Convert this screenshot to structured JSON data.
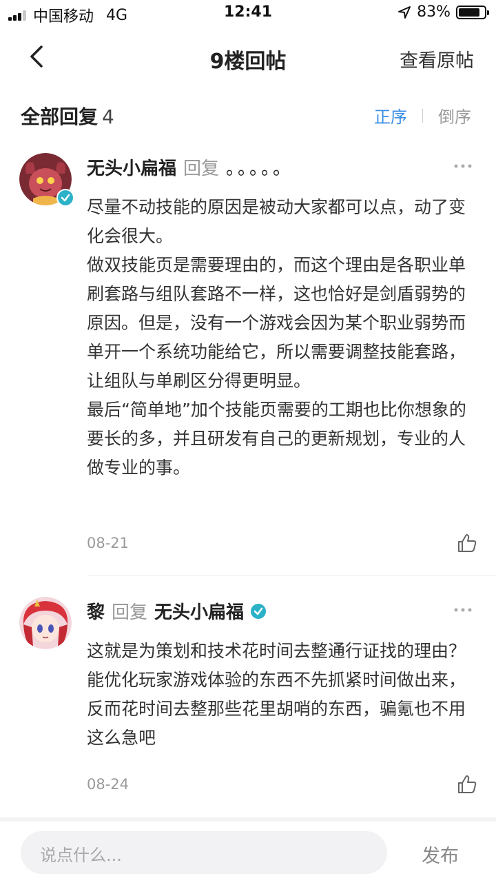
{
  "status_bar": {
    "carrier": "中国移动",
    "network": "4G",
    "time": "12:41",
    "battery": "83%",
    "battery_level": 0.83
  },
  "nav": {
    "title": "9楼回帖",
    "action": "查看原帖"
  },
  "replies_header": {
    "title": "全部回复",
    "count": "4",
    "sort_asc": "正序",
    "sort_desc": "倒序"
  },
  "replies": [
    {
      "author": "无头小扁福",
      "reply_word": "回复",
      "reply_to": "。。。。。",
      "paragraphs": [
        "尽量不动技能的原因是被动大家都可以点，动了变化会很大。",
        "做双技能页是需要理由的，而这个理由是各职业单刷套路与组队套路不一样，这也恰好是剑盾弱势的原因。但是，没有一个游戏会因为某个职业弱势而单开一个系统功能给它，所以需要调整技能套路，让组队与单刷区分得更明显。",
        "最后“简单地”加个技能页需要的工期也比你想象的要长的多，并且研发有自己的更新规划，专业的人做专业的事。"
      ],
      "date": "08-21"
    },
    {
      "author": "黎",
      "reply_word": "回复",
      "reply_to": "无头小扁福",
      "paragraphs": [
        "这就是为策划和技术花时间去整通行证找的理由？能优化玩家游戏体验的东西不先抓紧时间做出来，反而花时间去整那些花里胡哨的东西，骗氪也不用这么急吧"
      ],
      "date": "08-24"
    }
  ],
  "footer": {
    "input_placeholder": "说点什么...",
    "publish_label": "发布"
  },
  "colors": {
    "accent": "#3a8ee6",
    "verified": "#2bb1c8",
    "muted": "#9a9a9a"
  },
  "icons": [
    "signal-icon",
    "location-arrow-icon",
    "battery-icon",
    "back-chevron-icon",
    "verified-badge-icon",
    "more-dots-icon",
    "thumbs-up-icon"
  ]
}
